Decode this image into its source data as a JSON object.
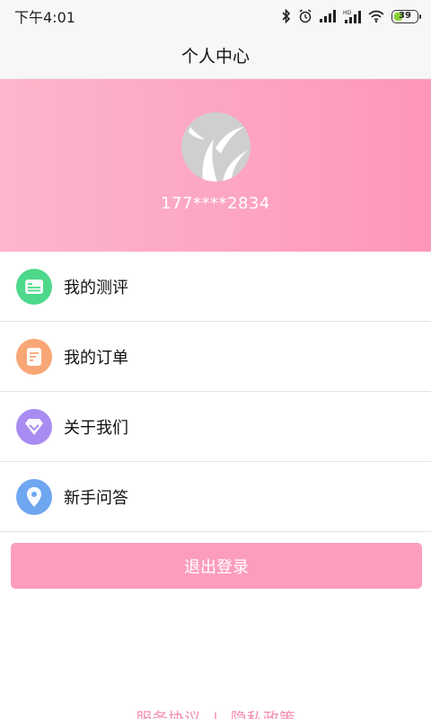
{
  "status_bar": {
    "time": "下午4:01",
    "battery_level": "39",
    "battery_color": "#8cd13b",
    "icons": [
      "bluetooth-icon",
      "alarm-icon",
      "signal-icon",
      "hd-signal-icon",
      "wifi-icon",
      "battery-icon"
    ]
  },
  "header": {
    "title": "个人中心"
  },
  "profile": {
    "phone": "177****2834",
    "avatar_icon": "leaf-logo-icon",
    "gradient_start": "#fdb6cc",
    "gradient_end": "#fd97b8"
  },
  "menu": {
    "items": [
      {
        "label": "我的测评",
        "icon": "evaluation-icon",
        "color": "#4ed88c"
      },
      {
        "label": "我的订单",
        "icon": "order-icon",
        "color": "#f9a676"
      },
      {
        "label": "关于我们",
        "icon": "diamond-icon",
        "color": "#a98cf2"
      },
      {
        "label": "新手问答",
        "icon": "location-pin-icon",
        "color": "#6fa6f0"
      }
    ]
  },
  "actions": {
    "logout_label": "退出登录",
    "accent_color": "#fd9dbd"
  },
  "footer": {
    "service_agreement": "服务协议",
    "separator": "|",
    "privacy_policy": "隐私政策"
  }
}
